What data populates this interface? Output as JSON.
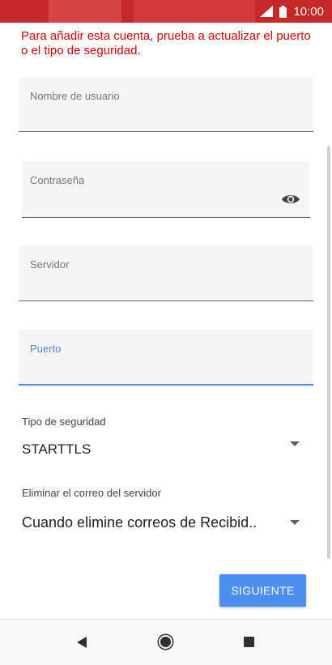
{
  "status_bar": {
    "time": "10:00",
    "icons": [
      "signal-icon",
      "battery-icon"
    ],
    "color": "#c62828"
  },
  "error_message": "Para añadir esta cuenta, prueba a actualizar el puerto o el tipo de seguridad.",
  "fields": {
    "username": {
      "label": "Nombre de usuario",
      "value": ""
    },
    "password": {
      "label": "Contraseña",
      "value": "",
      "toggle_icon": "eye-icon"
    },
    "server": {
      "label": "Servidor",
      "value": ""
    },
    "port": {
      "label": "Puerto",
      "value": "",
      "focused": true
    }
  },
  "security": {
    "label": "Tipo de seguridad",
    "selected": "STARTTLS"
  },
  "delete_from_server": {
    "label": "Eliminar el correo del servidor",
    "selected": "Cuando elimine correos de Recibid.."
  },
  "next_button": {
    "label": "SIGUIENTE",
    "color": "#4d8ff0"
  },
  "nav_bar": {
    "icons": [
      "back-icon",
      "home-icon",
      "recents-icon"
    ]
  }
}
